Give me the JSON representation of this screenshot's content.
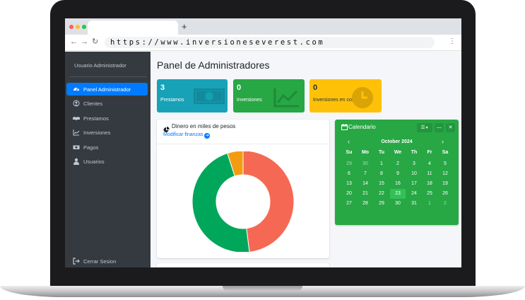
{
  "browser": {
    "url": "https://www.inversioneseverest.com",
    "new_tab_label": "+",
    "back_icon": "arrow-left-icon",
    "forward_icon": "arrow-right-icon",
    "menu_icon": "kebab-menu-icon"
  },
  "sidebar": {
    "brand": "Usuario Administrador",
    "items": [
      {
        "label": "Panel Administrador",
        "icon": "tachometer-icon",
        "active": true
      },
      {
        "label": "Clientes",
        "icon": "user-circle-icon",
        "active": false
      },
      {
        "label": "Prestamos",
        "icon": "handshake-icon",
        "active": false
      },
      {
        "label": "Inversiones",
        "icon": "chart-line-icon",
        "active": false
      },
      {
        "label": "Pagos",
        "icon": "money-bill-icon",
        "active": false
      },
      {
        "label": "Usuarios",
        "icon": "user-icon",
        "active": false
      }
    ],
    "logout": {
      "label": "Cerrar Sesion",
      "icon": "sign-out-icon"
    }
  },
  "page": {
    "title": "Panel de Administradores"
  },
  "stats": [
    {
      "value": "3",
      "label": "Prestamos",
      "color": "#17a2b8",
      "icon": "money-bill-icon"
    },
    {
      "value": "0",
      "label": "Inversiones",
      "color": "#28a745",
      "icon": "chart-line-icon"
    },
    {
      "value": "0",
      "label": "Inversiones en cola",
      "color": "#ffc107",
      "icon": "clock-icon"
    }
  ],
  "finance_card": {
    "title": "Dinero en miles de pesos",
    "link": "Modificar finanzas"
  },
  "chart_data": {
    "type": "pie",
    "donut": true,
    "slices": [
      {
        "value": 48,
        "color": "#f56954"
      },
      {
        "value": 47,
        "color": "#00a65a"
      },
      {
        "value": 5,
        "color": "#f39c12"
      }
    ]
  },
  "calendar": {
    "title": "Calendario",
    "month": "October 2024",
    "weekdays": [
      "Su",
      "Mo",
      "Tu",
      "We",
      "Th",
      "Fr",
      "Sa"
    ],
    "weeks": [
      [
        "29",
        "30",
        "1",
        "2",
        "3",
        "4",
        "5"
      ],
      [
        "6",
        "7",
        "8",
        "9",
        "10",
        "11",
        "12"
      ],
      [
        "13",
        "14",
        "15",
        "16",
        "17",
        "18",
        "19"
      ],
      [
        "20",
        "21",
        "22",
        "23",
        "24",
        "25",
        "26"
      ],
      [
        "27",
        "28",
        "29",
        "30",
        "31",
        "1",
        "2"
      ]
    ],
    "muted": [
      [
        0,
        0
      ],
      [
        0,
        1
      ],
      [
        4,
        5
      ],
      [
        4,
        6
      ]
    ],
    "today": [
      3,
      3
    ],
    "accent": "#28a745"
  }
}
